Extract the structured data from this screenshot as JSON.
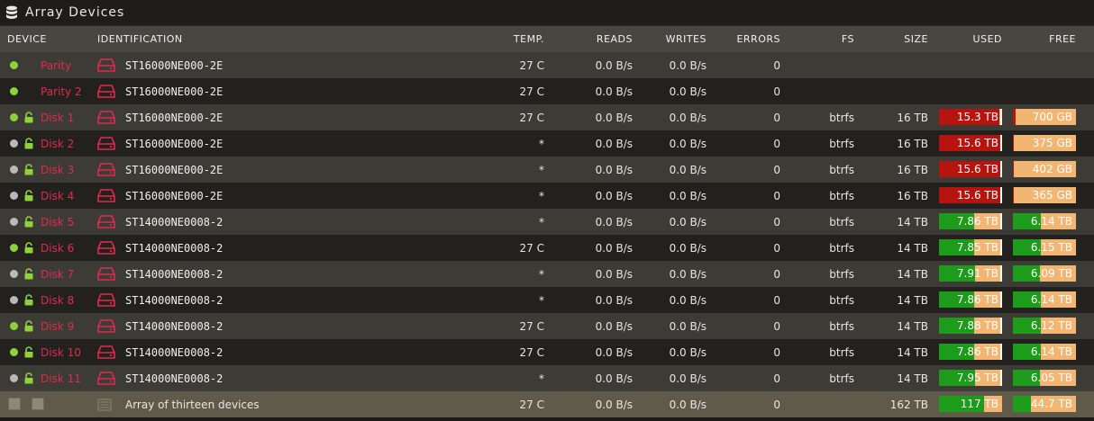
{
  "title": "Array Devices",
  "icons": {
    "title": "database-icon",
    "drive": "hard-drive-icon",
    "lock": "unlock-icon",
    "status": "status-dot-icon"
  },
  "colors": {
    "accent": "#e22a4f",
    "online": "#8fd13b",
    "spun_down": "#b9b9b9",
    "used_high": "#b8140f",
    "used_ok": "#1d9b1a",
    "free_bar": "#f3b572"
  },
  "columns": {
    "device": "DEVICE",
    "identification": "IDENTIFICATION",
    "temp": "TEMP.",
    "reads": "READS",
    "writes": "WRITES",
    "errors": "ERRORS",
    "fs": "FS",
    "size": "SIZE",
    "used": "USED",
    "free": "FREE"
  },
  "devices": [
    {
      "name": "Parity",
      "status": "online",
      "locked": false,
      "id": "ST16000NE000-2E",
      "temp": "27 C",
      "reads": "0.0 B/s",
      "writes": "0.0 B/s",
      "errors": "0",
      "fs": "",
      "size": "",
      "used": "",
      "free": ""
    },
    {
      "name": "Parity 2",
      "status": "online",
      "locked": false,
      "id": "ST16000NE000-2E",
      "temp": "27 C",
      "reads": "0.0 B/s",
      "writes": "0.0 B/s",
      "errors": "0",
      "fs": "",
      "size": "",
      "used": "",
      "free": ""
    },
    {
      "name": "Disk 1",
      "status": "online",
      "locked": true,
      "id": "ST16000NE000-2E",
      "temp": "27 C",
      "reads": "0.0 B/s",
      "writes": "0.0 B/s",
      "errors": "0",
      "fs": "btrfs",
      "size": "16 TB",
      "used": "15.3 TB",
      "free": "700 GB",
      "used_frac": 0.95,
      "free_frac": 0.04,
      "level": "high"
    },
    {
      "name": "Disk 2",
      "status": "spun_down",
      "locked": true,
      "id": "ST16000NE000-2E",
      "temp": "*",
      "reads": "0.0 B/s",
      "writes": "0.0 B/s",
      "errors": "0",
      "fs": "btrfs",
      "size": "16 TB",
      "used": "15.6 TB",
      "free": "375 GB",
      "used_frac": 0.97,
      "free_frac": 0.02,
      "level": "high"
    },
    {
      "name": "Disk 3",
      "status": "spun_down",
      "locked": true,
      "id": "ST16000NE000-2E",
      "temp": "*",
      "reads": "0.0 B/s",
      "writes": "0.0 B/s",
      "errors": "0",
      "fs": "btrfs",
      "size": "16 TB",
      "used": "15.6 TB",
      "free": "402 GB",
      "used_frac": 0.97,
      "free_frac": 0.02,
      "level": "high"
    },
    {
      "name": "Disk 4",
      "status": "spun_down",
      "locked": true,
      "id": "ST16000NE000-2E",
      "temp": "*",
      "reads": "0.0 B/s",
      "writes": "0.0 B/s",
      "errors": "0",
      "fs": "btrfs",
      "size": "16 TB",
      "used": "15.6 TB",
      "free": "365 GB",
      "used_frac": 0.97,
      "free_frac": 0.02,
      "level": "high"
    },
    {
      "name": "Disk 5",
      "status": "spun_down",
      "locked": true,
      "id": "ST14000NE0008-2",
      "temp": "*",
      "reads": "0.0 B/s",
      "writes": "0.0 B/s",
      "errors": "0",
      "fs": "btrfs",
      "size": "14 TB",
      "used": "7.86 TB",
      "free": "6.14 TB",
      "used_frac": 0.56,
      "free_frac": 0.44,
      "level": "ok"
    },
    {
      "name": "Disk 6",
      "status": "online",
      "locked": true,
      "id": "ST14000NE0008-2",
      "temp": "27 C",
      "reads": "0.0 B/s",
      "writes": "0.0 B/s",
      "errors": "0",
      "fs": "btrfs",
      "size": "14 TB",
      "used": "7.85 TB",
      "free": "6.15 TB",
      "used_frac": 0.56,
      "free_frac": 0.44,
      "level": "ok"
    },
    {
      "name": "Disk 7",
      "status": "spun_down",
      "locked": true,
      "id": "ST14000NE0008-2",
      "temp": "*",
      "reads": "0.0 B/s",
      "writes": "0.0 B/s",
      "errors": "0",
      "fs": "btrfs",
      "size": "14 TB",
      "used": "7.91 TB",
      "free": "6.09 TB",
      "used_frac": 0.565,
      "free_frac": 0.435,
      "level": "ok"
    },
    {
      "name": "Disk 8",
      "status": "spun_down",
      "locked": true,
      "id": "ST14000NE0008-2",
      "temp": "*",
      "reads": "0.0 B/s",
      "writes": "0.0 B/s",
      "errors": "0",
      "fs": "btrfs",
      "size": "14 TB",
      "used": "7.86 TB",
      "free": "6.14 TB",
      "used_frac": 0.56,
      "free_frac": 0.44,
      "level": "ok"
    },
    {
      "name": "Disk 9",
      "status": "online",
      "locked": true,
      "id": "ST14000NE0008-2",
      "temp": "27 C",
      "reads": "0.0 B/s",
      "writes": "0.0 B/s",
      "errors": "0",
      "fs": "btrfs",
      "size": "14 TB",
      "used": "7.88 TB",
      "free": "6.12 TB",
      "used_frac": 0.563,
      "free_frac": 0.437,
      "level": "ok"
    },
    {
      "name": "Disk 10",
      "status": "online",
      "locked": true,
      "id": "ST14000NE0008-2",
      "temp": "27 C",
      "reads": "0.0 B/s",
      "writes": "0.0 B/s",
      "errors": "0",
      "fs": "btrfs",
      "size": "14 TB",
      "used": "7.86 TB",
      "free": "6.14 TB",
      "used_frac": 0.56,
      "free_frac": 0.44,
      "level": "ok"
    },
    {
      "name": "Disk 11",
      "status": "spun_down",
      "locked": true,
      "id": "ST14000NE0008-2",
      "temp": "*",
      "reads": "0.0 B/s",
      "writes": "0.0 B/s",
      "errors": "0",
      "fs": "btrfs",
      "size": "14 TB",
      "used": "7.95 TB",
      "free": "6.05 TB",
      "used_frac": 0.568,
      "free_frac": 0.432,
      "level": "ok"
    }
  ],
  "total": {
    "label": "Array of thirteen devices",
    "temp": "27 C",
    "reads": "0.0 B/s",
    "writes": "0.0 B/s",
    "errors": "0",
    "size": "162 TB",
    "used": "117 TB",
    "free": "44.7 TB",
    "used_frac": 0.72,
    "free_frac": 0.28,
    "level": "ok"
  }
}
